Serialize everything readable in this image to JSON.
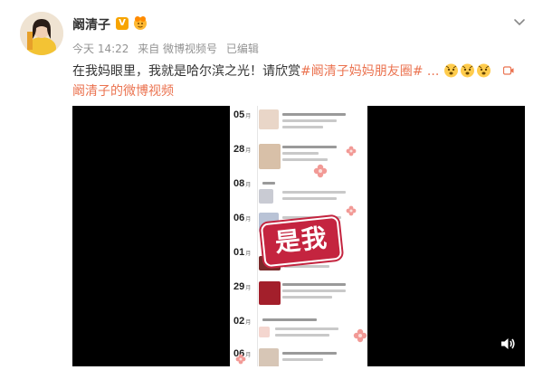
{
  "post": {
    "username": "阚清子",
    "verified_badge": "V",
    "time": "今天 14:22",
    "source": "来自 微博视频号",
    "edited": "已编辑",
    "text_main": "在我妈眼里，我就是哈尔滨之光！请欣赏",
    "hashtag": "#阚清子妈妈朋友圈#",
    "ellipsis": "...",
    "link_text": "阚清子的微博视频"
  },
  "video": {
    "overlay_text": "是我",
    "timeline": [
      {
        "day": "05",
        "mon": "月"
      },
      {
        "day": "28",
        "mon": "月"
      },
      {
        "day": "08",
        "mon": "月"
      },
      {
        "day": "06",
        "mon": "月"
      },
      {
        "day": "01",
        "mon": "月"
      },
      {
        "day": "29",
        "mon": "月"
      },
      {
        "day": "02",
        "mon": "月"
      },
      {
        "day": "06",
        "mon": "月"
      }
    ]
  },
  "colors": {
    "accent": "#eb7350",
    "text": "#333333",
    "meta": "#939393",
    "video_bg": "#000000",
    "overlay": "#c4243f"
  },
  "icons": [
    "chevron-down-icon",
    "verified-v-icon",
    "fan-badge-icon",
    "video-link-icon",
    "volume-icon",
    "emoji-icon"
  ]
}
